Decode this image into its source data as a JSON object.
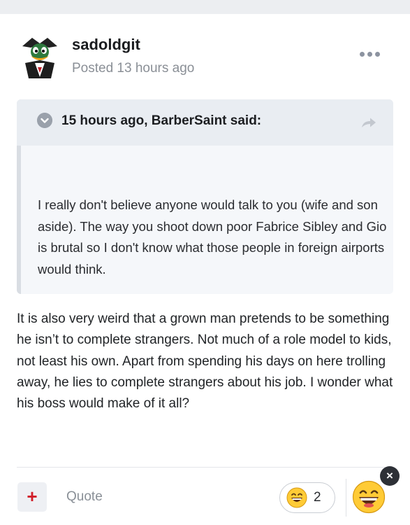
{
  "post": {
    "author": "sadoldgit",
    "timestamp": "Posted 13 hours ago",
    "quote": {
      "header": "15 hours ago, BarberSaint said:",
      "text": "I really don't believe anyone would talk to you (wife and son aside).  The way you shoot down poor Fabrice Sibley and Gio is brutal so I don't know what those people in foreign airports would think."
    },
    "body": "It is also very weird that a grown man pretends to be something he isn’t to complete strangers. Not much of a role model to kids, not least his own. Apart from spending his days on here trolling away, he lies to complete strangers about his job. I wonder what his boss would make of it all?"
  },
  "actions": {
    "plus_icon": "+",
    "quote_label": "Quote",
    "reaction_count": "2",
    "close_icon": "×"
  },
  "icons": {
    "avatar": "duck-vampire-avatar",
    "more": "ellipsis-icon",
    "quote_toggle": "chevron-down-icon",
    "quote_share": "share-arrow-icon",
    "reaction": "grinning-face-icon"
  },
  "colors": {
    "accent_red": "#d11f2a",
    "muted_text": "#8a8f96",
    "quote_bg": "#f5f7fa",
    "quote_header_bg": "#e9edf2"
  }
}
